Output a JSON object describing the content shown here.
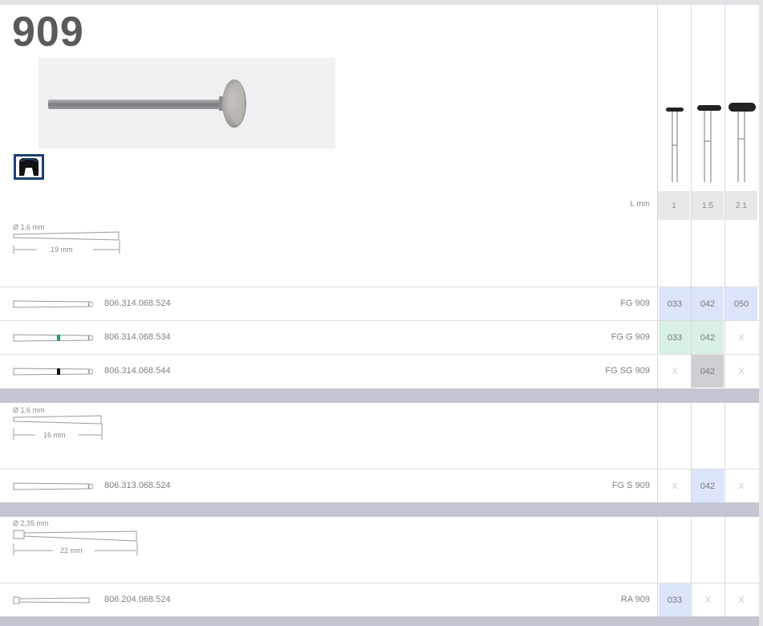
{
  "product": {
    "number": "909",
    "photo_icon": "diamond-wheel-bur-photo",
    "application_icon": "crown-prep-icon"
  },
  "table": {
    "l_label": "L mm",
    "lengths": [
      "1",
      "1.5",
      "2.1"
    ]
  },
  "groups": [
    {
      "diameter": "Ø 1,6 mm",
      "length": "19 mm",
      "rows": [
        {
          "code": "806.314.068.524",
          "name": "FG 909",
          "cells": [
            {
              "v": "033",
              "s": "blue"
            },
            {
              "v": "042",
              "s": "blue"
            },
            {
              "v": "050",
              "s": "blue"
            }
          ]
        },
        {
          "code": "806.314.068.534",
          "name": "FG G 909",
          "cells": [
            {
              "v": "033",
              "s": "green"
            },
            {
              "v": "042",
              "s": "green"
            },
            {
              "v": "X",
              "s": "x"
            }
          ]
        },
        {
          "code": "806.314.068.544",
          "name": "FG SG 909",
          "cells": [
            {
              "v": "X",
              "s": "x"
            },
            {
              "v": "042",
              "s": "gray"
            },
            {
              "v": "X",
              "s": "x"
            }
          ]
        }
      ]
    },
    {
      "diameter": "Ø 1,6 mm",
      "length": "16 mm",
      "rows": [
        {
          "code": "806.313.068.524",
          "name": "FG S 909",
          "cells": [
            {
              "v": "X",
              "s": "x"
            },
            {
              "v": "042",
              "s": "blue"
            },
            {
              "v": "X",
              "s": "x"
            }
          ]
        }
      ]
    },
    {
      "diameter": "Ø 2,35 mm",
      "length": "22 mm",
      "rows": [
        {
          "code": "806.204.068.524",
          "name": "RA 909",
          "cells": [
            {
              "v": "033",
              "s": "blue"
            },
            {
              "v": "X",
              "s": "x"
            },
            {
              "v": "X",
              "s": "x"
            }
          ]
        }
      ]
    }
  ],
  "colors": {
    "blue": "#dce5fb",
    "green": "#d9f1e3",
    "gray": "#cfcfd4",
    "separator": "#c3c6d0"
  }
}
